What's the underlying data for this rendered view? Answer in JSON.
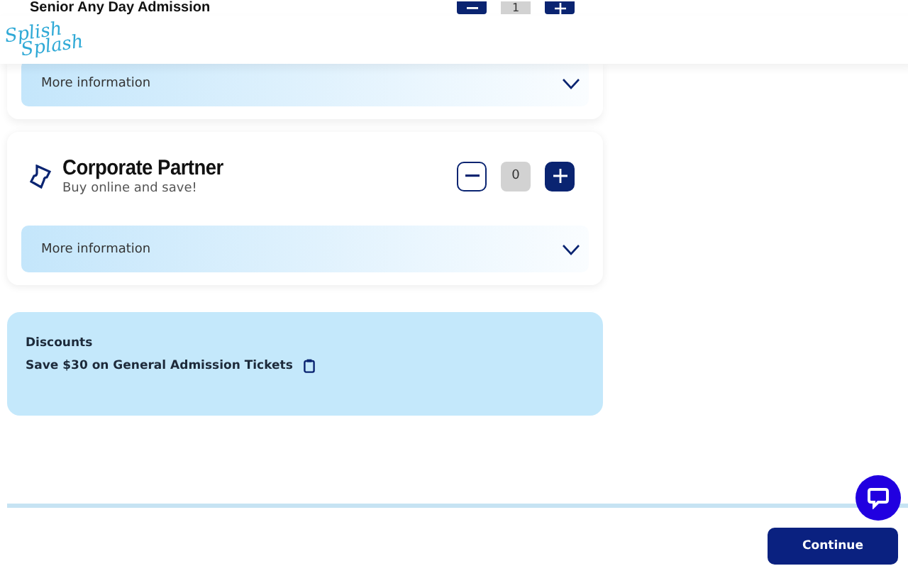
{
  "header": {
    "logo": [
      "Splish",
      "Splash"
    ]
  },
  "tickets": [
    {
      "title": "Senior Any Day Admission",
      "quantity": "1",
      "minus_enabled": true,
      "more": "More information",
      "expanded": false
    },
    {
      "title": "Corporate Partner",
      "subtitle": "Buy online and save!",
      "quantity": "0",
      "minus_enabled": false,
      "more": "More information",
      "expanded": false
    }
  ],
  "discounts": {
    "title": "Discounts",
    "items": [
      "Save $30 on General Admission Tickets"
    ]
  },
  "footer": {
    "button": "Continue"
  }
}
